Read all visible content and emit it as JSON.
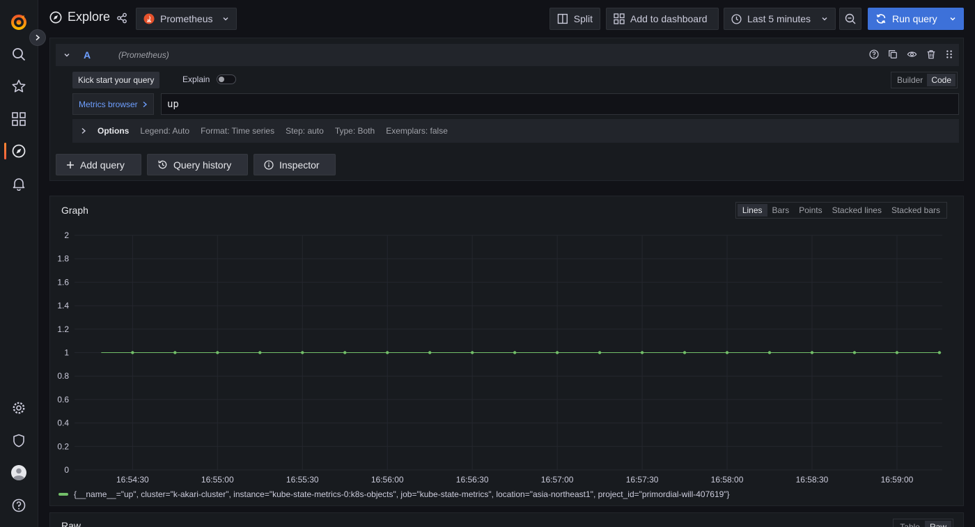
{
  "app": {
    "title": "Explore"
  },
  "sidebar": {
    "items": [
      {
        "icon": "grafana-logo-icon"
      },
      {
        "icon": "search-icon"
      },
      {
        "icon": "star-icon"
      },
      {
        "icon": "dashboards-icon"
      },
      {
        "icon": "explore-icon",
        "active": true
      },
      {
        "icon": "bell-icon"
      },
      {
        "icon": "gear-icon"
      },
      {
        "icon": "shield-icon"
      },
      {
        "icon": "avatar"
      },
      {
        "icon": "help-icon"
      }
    ]
  },
  "toolbar": {
    "datasource": "Prometheus",
    "split_label": "Split",
    "add_dashboard_label": "Add to dashboard",
    "time_range": "Last 5 minutes",
    "run_query_label": "Run query"
  },
  "query": {
    "letter": "A",
    "datasource_hint": "(Prometheus)",
    "kick_start_label": "Kick start your query",
    "explain_label": "Explain",
    "mode_builder": "Builder",
    "mode_code": "Code",
    "metrics_browser_label": "Metrics browser",
    "expr": "up",
    "options": {
      "title": "Options",
      "legend": "Legend: Auto",
      "format": "Format: Time series",
      "step": "Step: auto",
      "type": "Type: Both",
      "exemplars": "Exemplars: false"
    },
    "add_query_label": "Add query",
    "query_history_label": "Query history",
    "inspector_label": "Inspector"
  },
  "graph": {
    "title": "Graph",
    "viz_options": [
      "Lines",
      "Bars",
      "Points",
      "Stacked lines",
      "Stacked bars"
    ],
    "active_viz": "Lines",
    "legend": "{__name__=\"up\", cluster=\"k-akari-cluster\", instance=\"kube-state-metrics-0:k8s-objects\", job=\"kube-state-metrics\", location=\"asia-northeast1\", project_id=\"primordial-will-407619\"}",
    "color": "#73bf69"
  },
  "chart_data": {
    "type": "line",
    "ylim": [
      0,
      2
    ],
    "yticks": [
      "0",
      "0.2",
      "0.4",
      "0.6",
      "0.8",
      "1",
      "1.2",
      "1.4",
      "1.6",
      "1.8",
      "2"
    ],
    "xticks": [
      "16:54:30",
      "16:55:00",
      "16:55:30",
      "16:56:00",
      "16:56:30",
      "16:57:00",
      "16:57:30",
      "16:58:00",
      "16:58:30",
      "16:59:00"
    ],
    "x": [
      "16:54:30",
      "16:54:45",
      "16:55:00",
      "16:55:15",
      "16:55:30",
      "16:55:45",
      "16:56:00",
      "16:56:15",
      "16:56:30",
      "16:56:45",
      "16:57:00",
      "16:57:15",
      "16:57:30",
      "16:57:45",
      "16:58:00",
      "16:58:15",
      "16:58:30",
      "16:58:45",
      "16:59:00",
      "16:59:15"
    ],
    "series": [
      {
        "values": [
          1,
          1,
          1,
          1,
          1,
          1,
          1,
          1,
          1,
          1,
          1,
          1,
          1,
          1,
          1,
          1,
          1,
          1,
          1,
          1
        ]
      }
    ]
  },
  "raw": {
    "title": "Raw",
    "options": [
      "Table",
      "Raw"
    ],
    "active": "Raw"
  }
}
